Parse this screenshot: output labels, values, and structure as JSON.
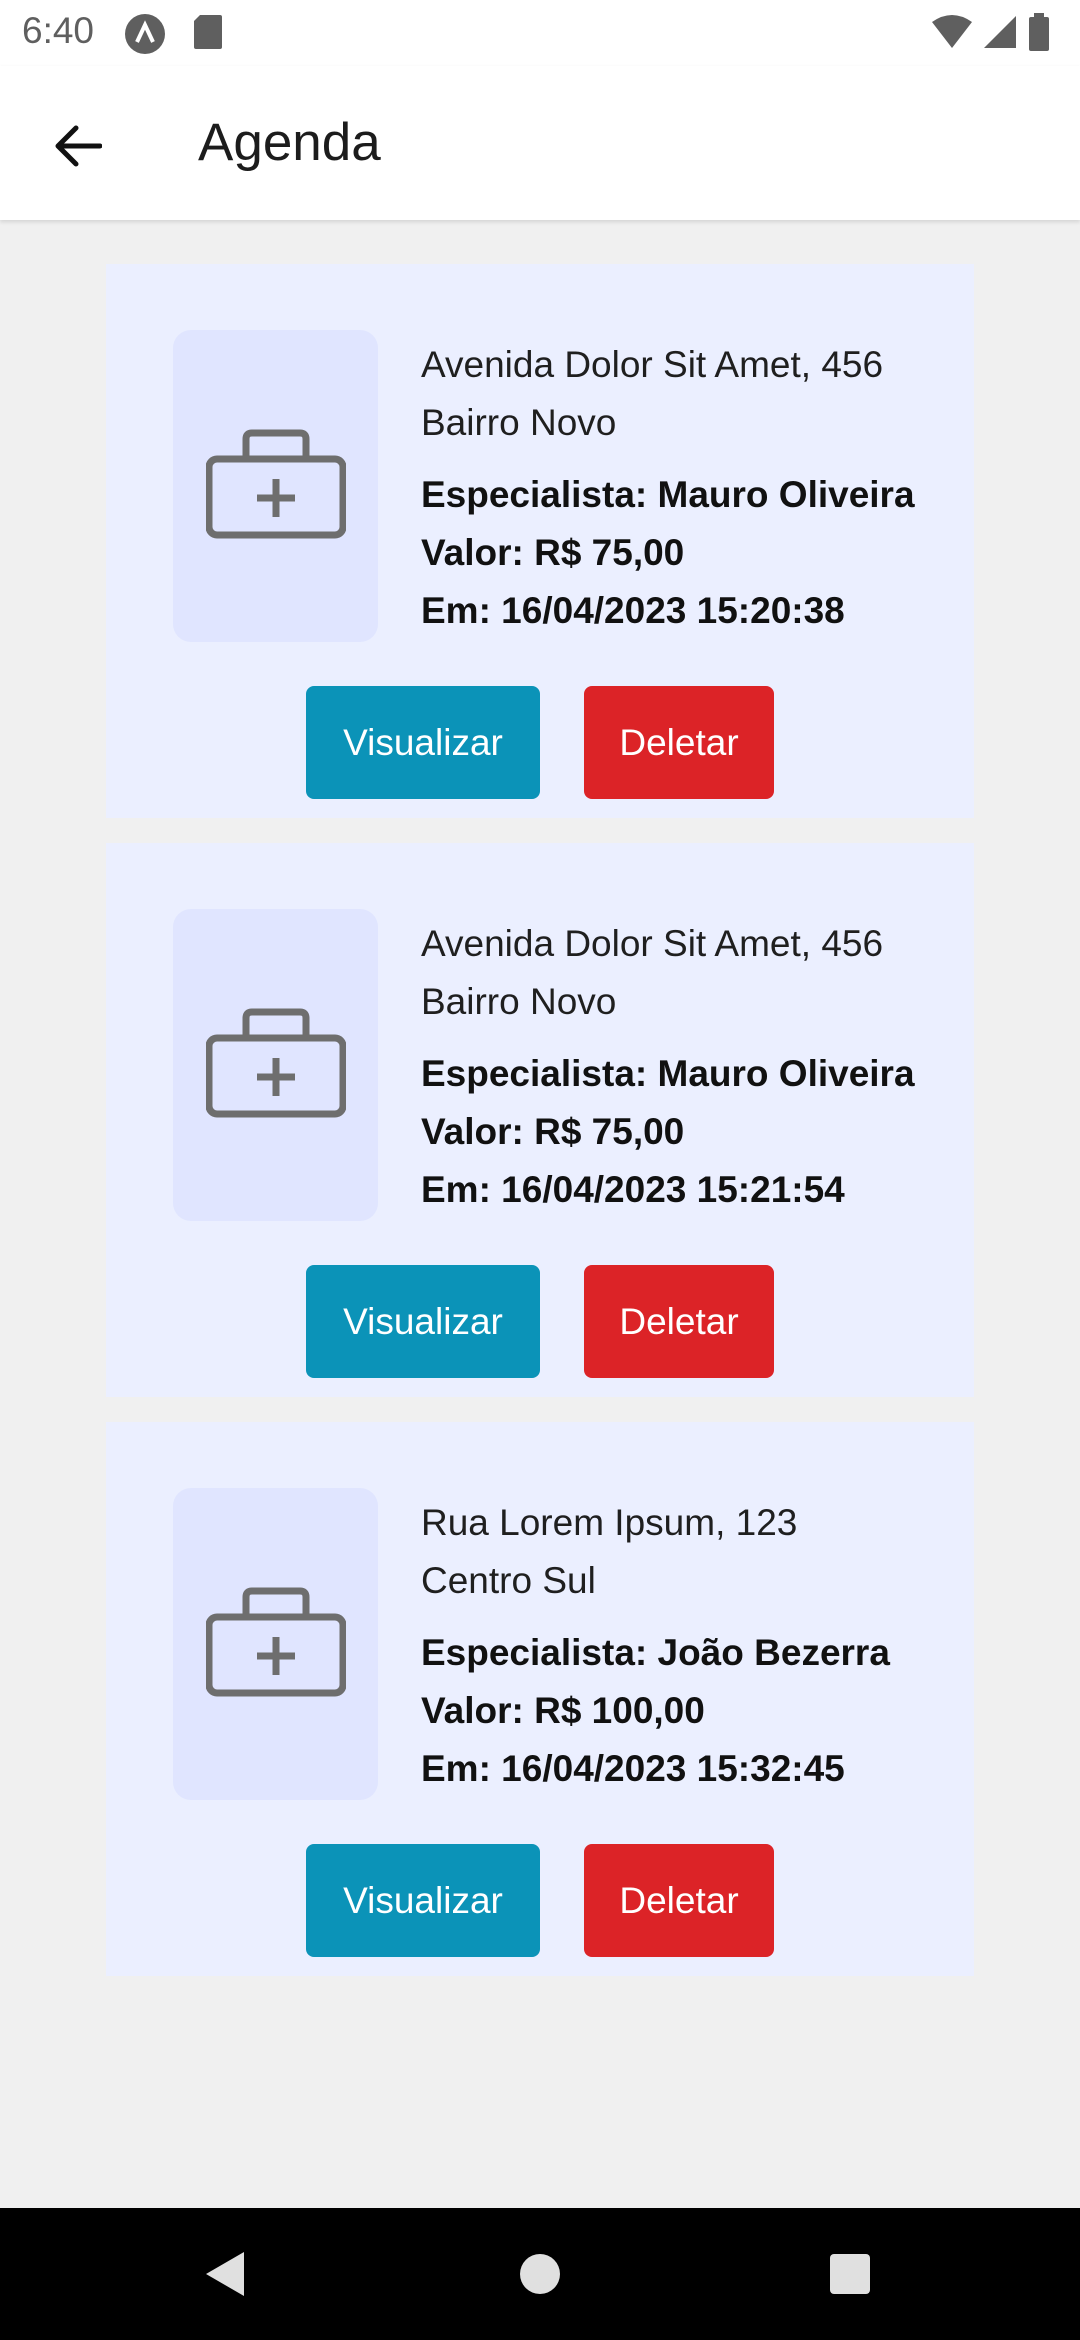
{
  "status_bar": {
    "time": "6:40",
    "icons": [
      "a-app-icon",
      "sd-card-icon",
      "wifi-icon",
      "signal-icon",
      "battery-icon"
    ]
  },
  "app_bar": {
    "back_icon": "arrow-back-icon",
    "title": "Agenda"
  },
  "appointments": [
    {
      "icon": "medical-kit-icon",
      "address_line1": "Avenida Dolor Sit Amet, 456",
      "address_line2": "Bairro Novo",
      "specialist": "Especialista: Mauro Oliveira",
      "value": "Valor: R$ 75,00",
      "date": "Em: 16/04/2023 15:20:38",
      "view_label": "Visualizar",
      "delete_label": "Deletar"
    },
    {
      "icon": "medical-kit-icon",
      "address_line1": "Avenida Dolor Sit Amet, 456",
      "address_line2": "Bairro Novo",
      "specialist": "Especialista: Mauro Oliveira",
      "value": "Valor: R$ 75,00",
      "date": "Em: 16/04/2023 15:21:54",
      "view_label": "Visualizar",
      "delete_label": "Deletar"
    },
    {
      "icon": "medical-kit-icon",
      "address_line1": "Rua Lorem Ipsum, 123",
      "address_line2": "Centro Sul",
      "specialist": "Especialista: João Bezerra",
      "value": "Valor: R$ 100,00",
      "date": "Em: 16/04/2023 15:32:45",
      "view_label": "Visualizar",
      "delete_label": "Deletar"
    }
  ],
  "nav_bar": {
    "icons": [
      "nav-back-icon",
      "nav-home-icon",
      "nav-recents-icon"
    ]
  },
  "colors": {
    "view_button": "#0b93b8",
    "delete_button": "#dc2327",
    "card_background": "#ebefff"
  }
}
